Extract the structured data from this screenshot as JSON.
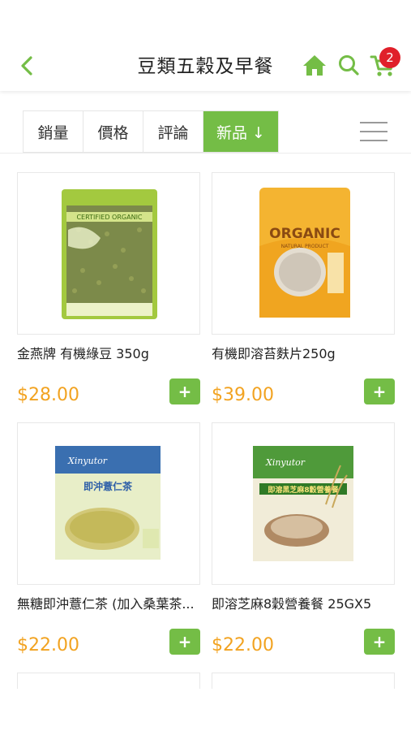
{
  "header": {
    "title": "豆類五穀及早餐",
    "cart_count": "2",
    "icons": [
      "back-icon",
      "home-icon",
      "search-icon",
      "cart-icon"
    ],
    "accent_color": "#74bd46"
  },
  "sort": {
    "tabs": [
      {
        "label": "銷量"
      },
      {
        "label": "價格"
      },
      {
        "label": "評論"
      },
      {
        "label": "新品 ↓"
      }
    ],
    "active_index": 3
  },
  "products": [
    {
      "name": "金燕牌 有機綠豆 350g",
      "price": "$28.00",
      "add_label": "+"
    },
    {
      "name": "有機即溶苔麩片250g",
      "price": "$39.00",
      "add_label": "+"
    },
    {
      "name": "無糖即沖薏仁茶 (加入桑葉茶...",
      "price": "$22.00",
      "add_label": "+"
    },
    {
      "name": "即溶芝麻8穀營養餐 25GX5",
      "price": "$22.00",
      "add_label": "+"
    }
  ],
  "product_images": {
    "p1": {
      "label_text": "CERTIFIED ORGANIC"
    },
    "p2": {
      "label_text": "ORGANIC",
      "sub_text": "NATURAL PRODUCT"
    },
    "p3": {
      "brand": "Xinyutor",
      "label_text": "即沖薏仁茶"
    },
    "p4": {
      "brand": "Xinyutor",
      "label_text": "即溶黑芝麻8穀營養餐"
    }
  }
}
